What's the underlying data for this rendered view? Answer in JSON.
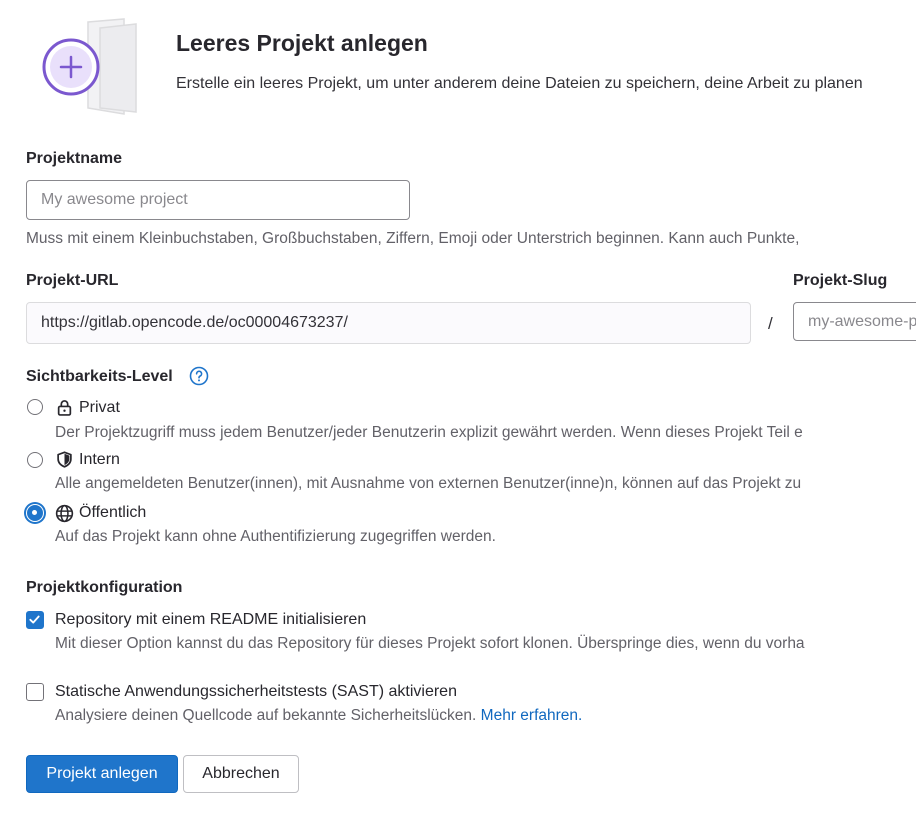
{
  "header": {
    "title": "Leeres Projekt anlegen",
    "subtitle": "Erstelle ein leeres Projekt, um unter anderem deine Dateien zu speichern, deine Arbeit zu planen"
  },
  "project_name": {
    "label": "Projektname",
    "placeholder": "My awesome project",
    "help": "Muss mit einem Kleinbuchstaben, Großbuchstaben, Ziffern, Emoji oder Unterstrich beginnen. Kann auch Punkte,"
  },
  "project_url": {
    "label": "Projekt-URL",
    "value": "https://gitlab.opencode.de/oc00004673237/",
    "separator": "/"
  },
  "project_slug": {
    "label": "Projekt-Slug",
    "placeholder": "my-awesome-project"
  },
  "visibility": {
    "label": "Sichtbarkeits-Level",
    "help_icon": "question-circle-icon",
    "options": [
      {
        "label": "Privat",
        "icon": "lock-icon",
        "description": "Der Projektzugriff muss jedem Benutzer/jeder Benutzerin explizit gewährt werden. Wenn dieses Projekt Teil e",
        "selected": false
      },
      {
        "label": "Intern",
        "icon": "shield-icon",
        "description": "Alle angemeldeten Benutzer(innen), mit Ausnahme von externen Benutzer(inne)n, können auf das Projekt zu",
        "selected": false
      },
      {
        "label": "Öffentlich",
        "icon": "globe-icon",
        "description": "Auf das Projekt kann ohne Authentifizierung zugegriffen werden.",
        "selected": true
      }
    ]
  },
  "configuration": {
    "label": "Projektkonfiguration",
    "readme": {
      "label": "Repository mit einem README initialisieren",
      "description": "Mit dieser Option kannst du das Repository für dieses Projekt sofort klonen. Überspringe dies, wenn du vorha",
      "checked": true
    },
    "sast": {
      "label": "Statische Anwendungssicherheitstests (SAST) aktivieren",
      "description": "Analysiere deinen Quellcode auf bekannte Sicherheitslücken.",
      "link": "Mehr erfahren.",
      "checked": false
    }
  },
  "actions": {
    "create": "Projekt anlegen",
    "cancel": "Abbrechen"
  },
  "colors": {
    "primary": "#1f75cb",
    "illustration_purple": "#7b58cf",
    "link": "#1068bf"
  }
}
